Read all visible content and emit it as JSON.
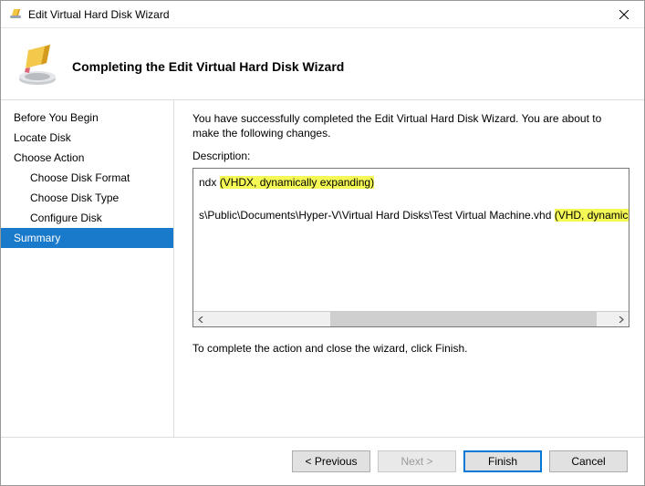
{
  "window": {
    "title": "Edit Virtual Hard Disk Wizard"
  },
  "header": {
    "heading": "Completing the Edit Virtual Hard Disk Wizard"
  },
  "sidebar": {
    "items": [
      {
        "label": "Before You Begin",
        "sub": false,
        "selected": false
      },
      {
        "label": "Locate Disk",
        "sub": false,
        "selected": false
      },
      {
        "label": "Choose Action",
        "sub": false,
        "selected": false
      },
      {
        "label": "Choose Disk Format",
        "sub": true,
        "selected": false
      },
      {
        "label": "Choose Disk Type",
        "sub": true,
        "selected": false
      },
      {
        "label": "Configure Disk",
        "sub": true,
        "selected": false
      },
      {
        "label": "Summary",
        "sub": false,
        "selected": true
      }
    ]
  },
  "content": {
    "intro": "You have successfully completed the Edit Virtual Hard Disk Wizard. You are about to make the following changes.",
    "description_label": "Description:",
    "line1_prefix": "ndx ",
    "line1_highlight": "(VHDX, dynamically expanding)",
    "line2_prefix": "s\\Public\\Documents\\Hyper-V\\Virtual Hard Disks\\Test Virtual Machine.vhd ",
    "line2_highlight": "(VHD, dynamically expanding)",
    "complete_hint": "To complete the action and close the wizard, click Finish."
  },
  "buttons": {
    "previous": "< Previous",
    "next": "Next >",
    "finish": "Finish",
    "cancel": "Cancel"
  }
}
